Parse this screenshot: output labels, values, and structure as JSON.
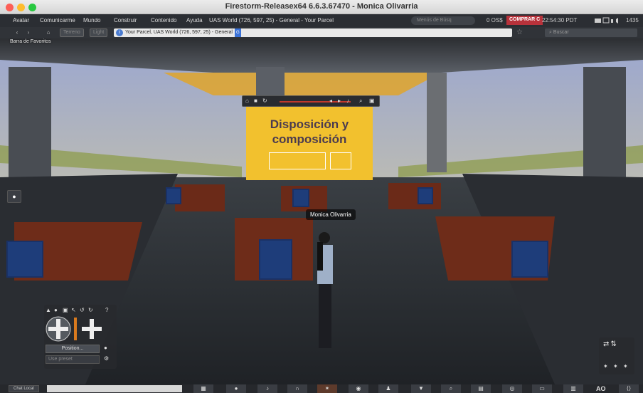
{
  "window": {
    "title": "Firestorm-Releasex64 6.6.3.67470 - Monica Olivarria"
  },
  "menubar": {
    "items": [
      "Avatar",
      "Comunicarme",
      "Mundo",
      "Construir",
      "Contenido",
      "Ayuda"
    ],
    "location": "UAS World (726, 597, 25) - General - Your Parcel",
    "menu_search_placeholder": "Menús de Búsq",
    "balance": "0 OS$",
    "buy_label": "COMPRAR C",
    "clock": "22:54:30 PDT",
    "fps": "1435"
  },
  "navbar": {
    "back_icon": "back-arrow-icon",
    "forward_icon": "forward-arrow-icon",
    "home_icon": "home-icon",
    "terrain_label": "Terreno",
    "lights_label": "Light",
    "address": "Your Parcel, UAS World (726, 597, 25) - General",
    "address_badge": "G",
    "search_placeholder": "Buscar"
  },
  "favorites_label": "Barra de Favoritos",
  "scene": {
    "slide_title": "Disposición y composición",
    "avatar_name": "Monica Olivarria"
  },
  "camera": {
    "position_label": "Position...",
    "preset_label": "Use preset"
  },
  "bottom": {
    "chat_label": "Chat Local",
    "ao_label": "AO"
  },
  "colors": {
    "slide_yellow": "#f2c12e",
    "buy_red": "#b8323b",
    "menubar_bg": "#2b2e33"
  }
}
